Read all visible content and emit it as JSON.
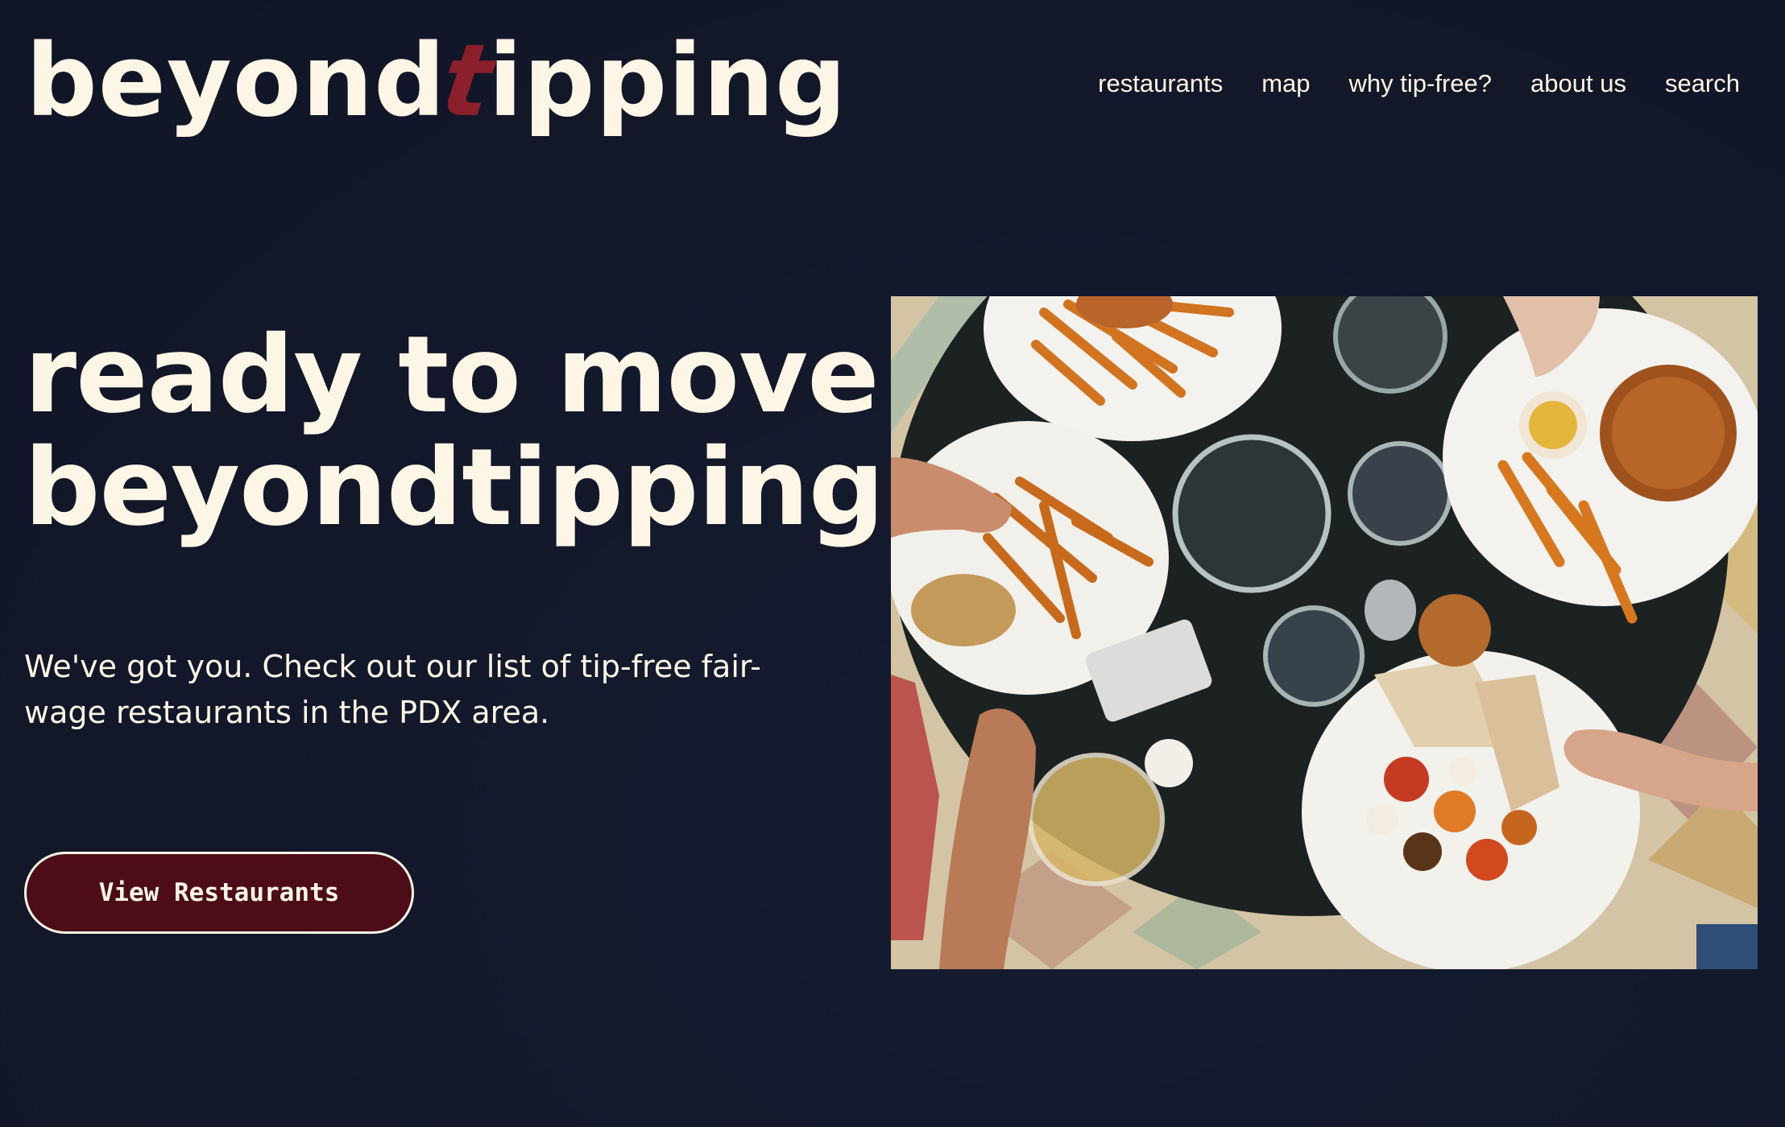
{
  "header": {
    "logo": {
      "text_before": "beyond",
      "text_accent": "t",
      "text_after": "ipping"
    },
    "nav": [
      {
        "label": "restaurants"
      },
      {
        "label": "map"
      },
      {
        "label": "why tip-free?"
      },
      {
        "label": "about us"
      },
      {
        "label": "search"
      }
    ]
  },
  "hero": {
    "title_line1": "ready to move",
    "title_line2": "beyondtipping?",
    "subtitle": "We've got you. Check out our list of tip-free fair-wage restaurants in the PDX area.",
    "cta_label": "View Restaurants",
    "image_subject": "overhead-table-of-burgers-fries-and-plates"
  },
  "colors": {
    "background": "#121829",
    "text": "#fdf6e6",
    "accent": "#8b1f2b",
    "button": "#4c0d18"
  }
}
